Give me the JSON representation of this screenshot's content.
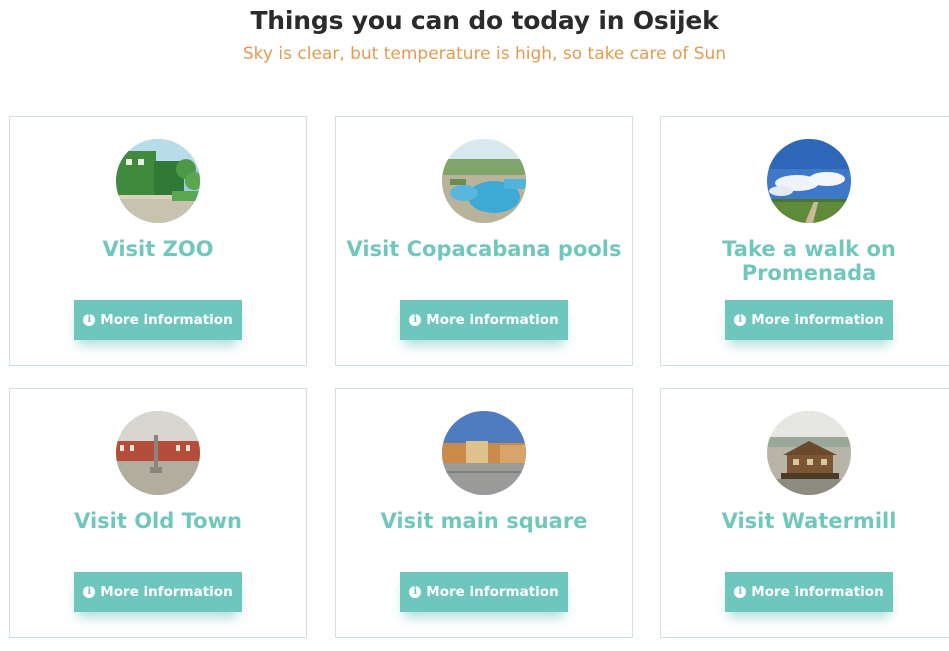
{
  "header": {
    "title": "Things you can do today in Osijek",
    "subtitle": "Sky is clear, but temperature is high, so take care of Sun"
  },
  "colors": {
    "accent": "#6fc6bd",
    "subtitle": "#e39b50",
    "title": "#2b2b2b",
    "card_border": "#cfe0e7"
  },
  "cards": [
    {
      "title": "Visit ZOO",
      "button": "More information",
      "image": "zoo-photo"
    },
    {
      "title": "Visit Copacabana pools",
      "button": "More information",
      "image": "pools-photo"
    },
    {
      "title": "Take a walk on Promenada",
      "button": "More information",
      "image": "promenade-photo"
    },
    {
      "title": "Visit Old Town",
      "button": "More information",
      "image": "old-town-photo"
    },
    {
      "title": "Visit main square",
      "button": "More information",
      "image": "main-square-photo"
    },
    {
      "title": "Visit Watermill",
      "button": "More information",
      "image": "watermill-photo"
    }
  ],
  "icons": {
    "button_icon": "info-circle-icon"
  }
}
